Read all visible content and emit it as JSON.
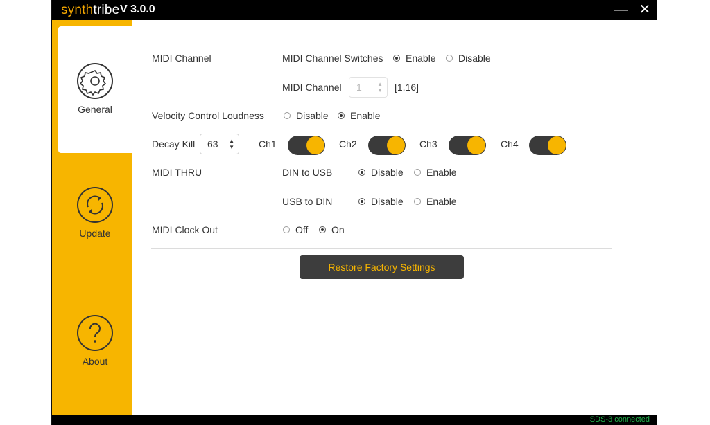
{
  "app": {
    "brand_prefix": "synth",
    "brand_suffix": "tribe",
    "version": "V 3.0.0"
  },
  "window": {
    "minimize_glyph": "—",
    "close_glyph": "✕"
  },
  "sidebar": {
    "items": [
      {
        "label": "General",
        "icon": "gear-icon",
        "active": true
      },
      {
        "label": "Update",
        "icon": "refresh-icon",
        "active": false
      },
      {
        "label": "About",
        "icon": "question-icon",
        "active": false
      }
    ]
  },
  "settings": {
    "midi_channel": {
      "label": "MIDI Channel",
      "switches_label": "MIDI Channel Switches",
      "switches_options": [
        "Enable",
        "Disable"
      ],
      "switches_selected": "Enable",
      "channel_label": "MIDI Channel",
      "channel_value": "1",
      "channel_range": "[1,16]"
    },
    "velocity": {
      "label": "Velocity Control Loudness",
      "options": [
        "Disable",
        "Enable"
      ],
      "selected": "Enable"
    },
    "decay_kill": {
      "label": "Decay Kill",
      "value": "63",
      "channels": [
        {
          "label": "Ch1",
          "on": true
        },
        {
          "label": "Ch2",
          "on": true
        },
        {
          "label": "Ch3",
          "on": true
        },
        {
          "label": "Ch4",
          "on": true
        }
      ]
    },
    "midi_thru": {
      "label": "MIDI THRU",
      "din_to_usb_label": "DIN to USB",
      "din_to_usb_options": [
        "Disable",
        "Enable"
      ],
      "din_to_usb_selected": "Disable",
      "usb_to_din_label": "USB to DIN",
      "usb_to_din_options": [
        "Disable",
        "Enable"
      ],
      "usb_to_din_selected": "Disable"
    },
    "midi_clock_out": {
      "label": "MIDI Clock Out",
      "options": [
        "Off",
        "On"
      ],
      "selected": "On"
    }
  },
  "restore_button": "Restore Factory Settings",
  "status": {
    "text": "SDS-3 connected",
    "color": "#22b24c"
  },
  "colors": {
    "accent": "#f7b500",
    "dark": "#3a3a3a",
    "titlebar": "#000000"
  }
}
